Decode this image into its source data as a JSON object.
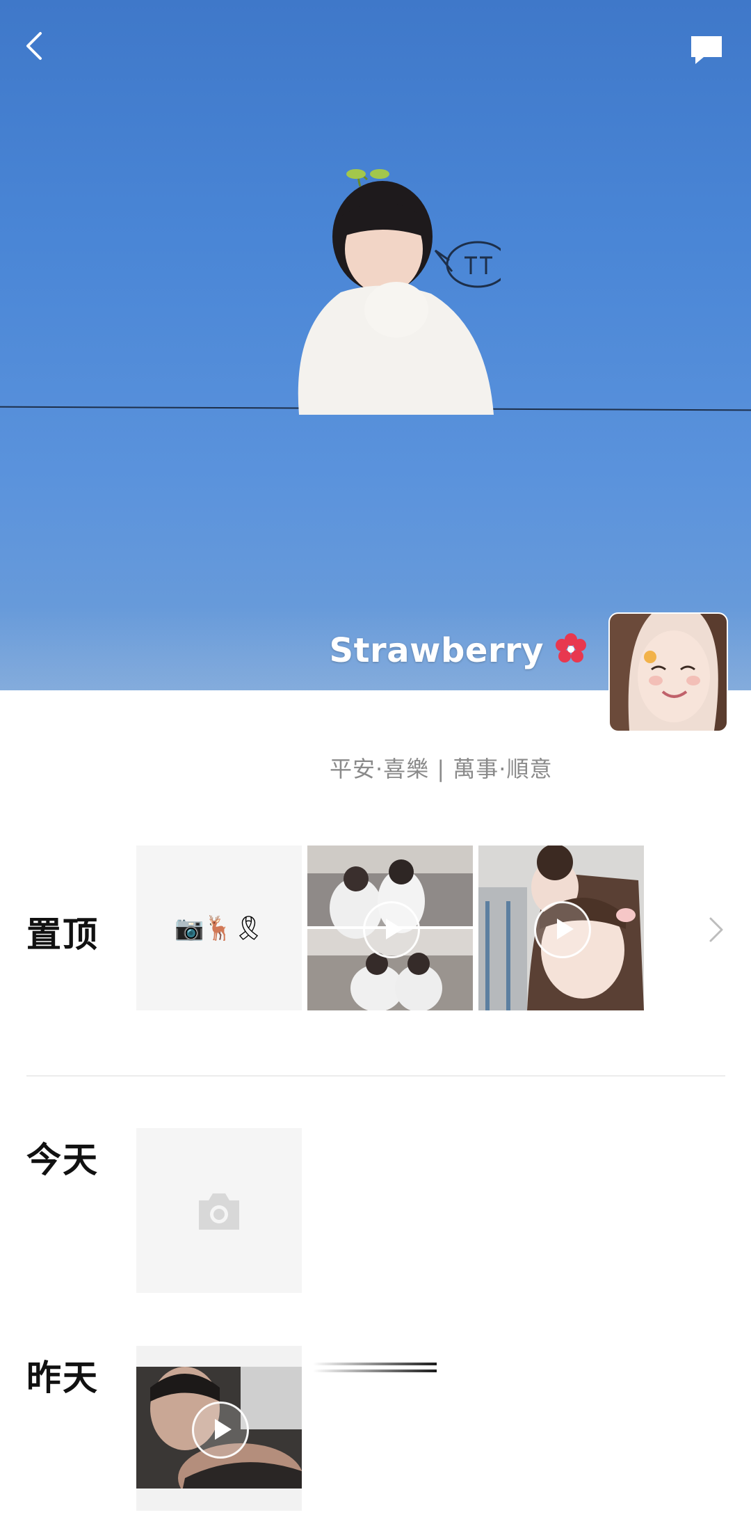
{
  "profile": {
    "name": "Strawberry",
    "signature": "平安·喜樂 | 萬事·順意"
  },
  "sections": {
    "pinned": {
      "label": "置顶",
      "emoji_post": "📷🦌🎗"
    },
    "today": {
      "label": "今天"
    },
    "yesterday": {
      "label": "昨天"
    }
  },
  "icons": {
    "back": "chevron-left-icon",
    "message": "chat-bubble-icon",
    "flower": "flower-icon",
    "more": "chevron-right-icon",
    "camera": "camera-icon",
    "play": "play-icon"
  },
  "colors": {
    "cover_blue": "#4a86d6",
    "flower_red": "#e8384f",
    "label_dark": "#111111",
    "signature_gray": "#8a8a8a",
    "tile_bg": "#f5f5f5"
  }
}
